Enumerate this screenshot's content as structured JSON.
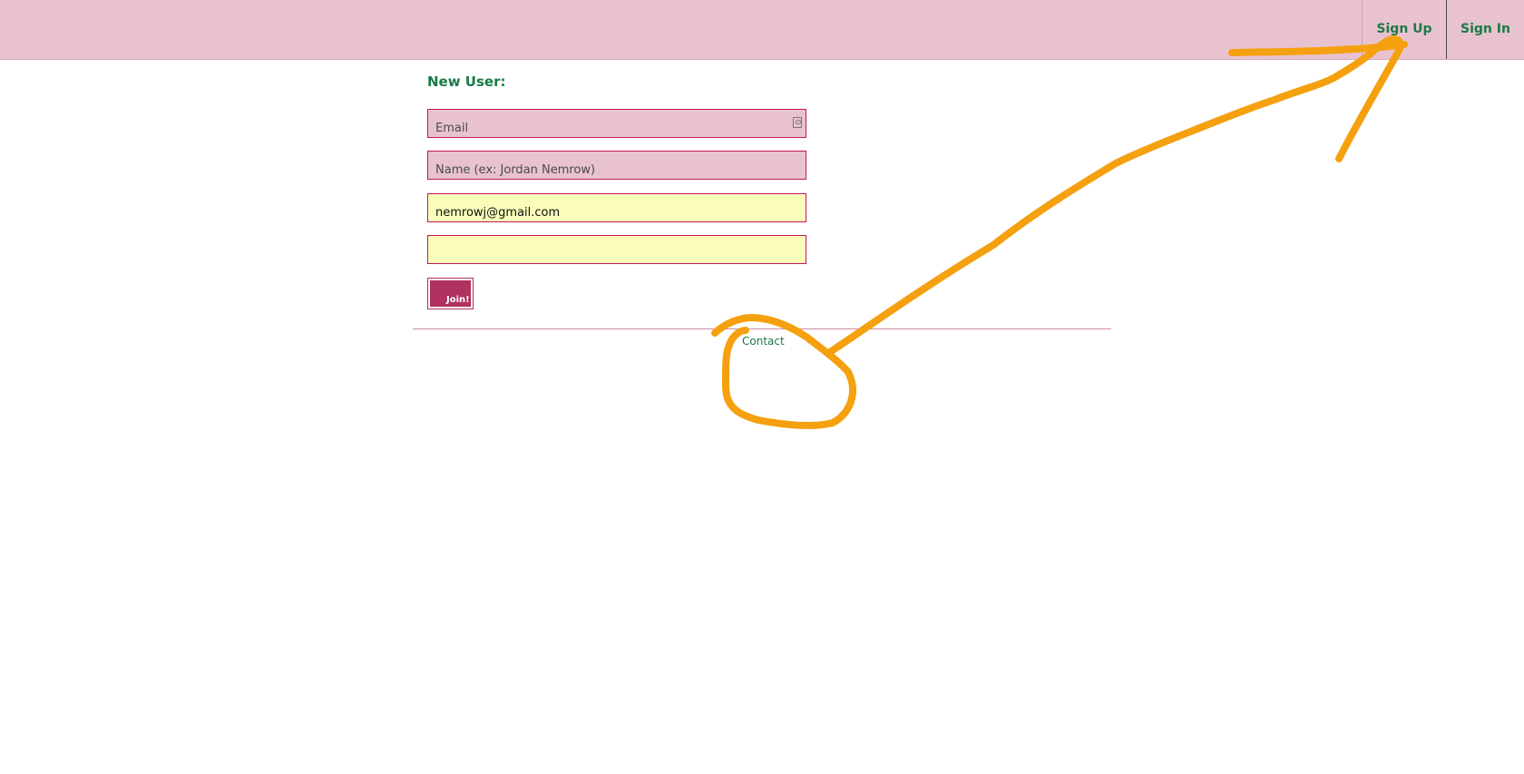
{
  "nav": {
    "sign_up": "Sign Up",
    "sign_in": "Sign In"
  },
  "form": {
    "title": "New User:",
    "email_placeholder": "Email",
    "name_placeholder": "Name (ex: Jordan Nemrow)",
    "username_value": "nemrowj@gmail.com",
    "password_value": "",
    "join_label": "Join!"
  },
  "footer": {
    "contact": "Contact"
  },
  "icons": {
    "email_field": "contact-card-icon"
  },
  "colors": {
    "header_bg": "#e8c3cf",
    "link_green": "#1a7a46",
    "field_border": "#c2185b",
    "autofill_yellow": "#fafdba",
    "button_bg": "#b03060",
    "annotation_orange": "#f5a00f"
  }
}
